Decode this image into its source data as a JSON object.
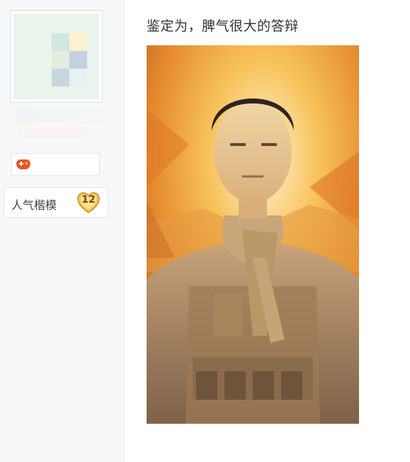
{
  "sidebar": {
    "avatar_label": "blurred-avatar",
    "badge_icon": "gamepad-icon",
    "level": {
      "label": "人气楷模",
      "number": "12"
    }
  },
  "post": {
    "title": "鉴定为，脾气很大的答辩",
    "image_icon": "photo-portrait"
  },
  "colors": {
    "sidebar_bg": "#f7f8fa",
    "accent_orange": "#e8552c",
    "badge_gold": "#f0c75a"
  }
}
